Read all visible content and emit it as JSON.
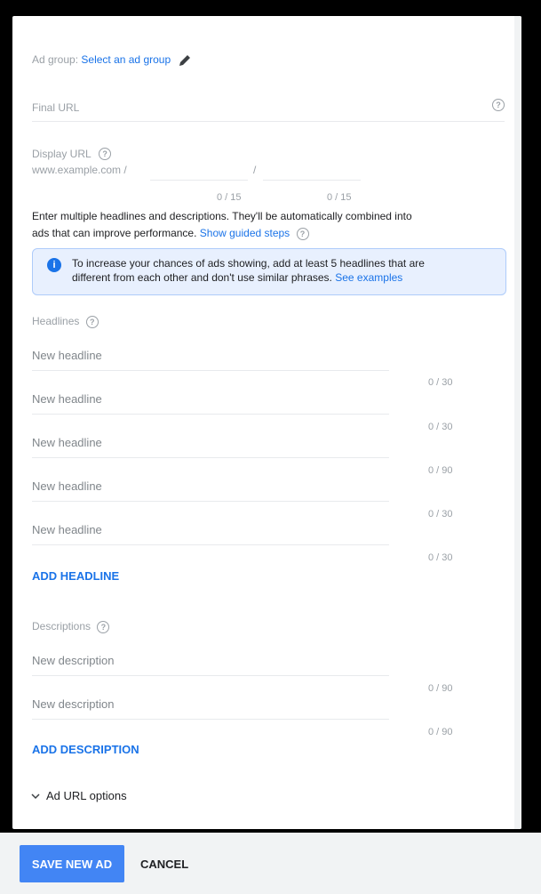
{
  "adgroup": {
    "label": "Ad group:",
    "link": "Select an ad group"
  },
  "final_url": {
    "label": "Final URL"
  },
  "display_url": {
    "label": "Display URL",
    "prefix": "www.example.com /",
    "sep": "/",
    "path1_counter": "0 / 15",
    "path2_counter": "0 / 15"
  },
  "intro": {
    "line1": "Enter multiple headlines and descriptions. They'll be automatically combined into",
    "line2": "ads that can improve performance.",
    "guided": "Show guided steps"
  },
  "info": {
    "line1": "To increase your chances of ads showing, add at least 5 headlines that are",
    "line2": "different from each other and don't use similar phrases.",
    "link": "See examples"
  },
  "headlines": {
    "label": "Headlines",
    "placeholder": "New headline",
    "counters": [
      "0 / 30",
      "0 / 30",
      "0 / 90",
      "0 / 30",
      "0 / 30"
    ],
    "add": "ADD HEADLINE"
  },
  "descriptions": {
    "label": "Descriptions",
    "placeholder": "New description",
    "counters": [
      "0 / 90",
      "0 / 90"
    ],
    "add": "ADD DESCRIPTION"
  },
  "url_options": "Ad URL options",
  "footer": {
    "save": "SAVE NEW AD",
    "cancel": "CANCEL"
  },
  "colors": {
    "accent": "#1a73e8",
    "primary_button": "#4285f4",
    "info_bg": "#e8f0fe"
  }
}
